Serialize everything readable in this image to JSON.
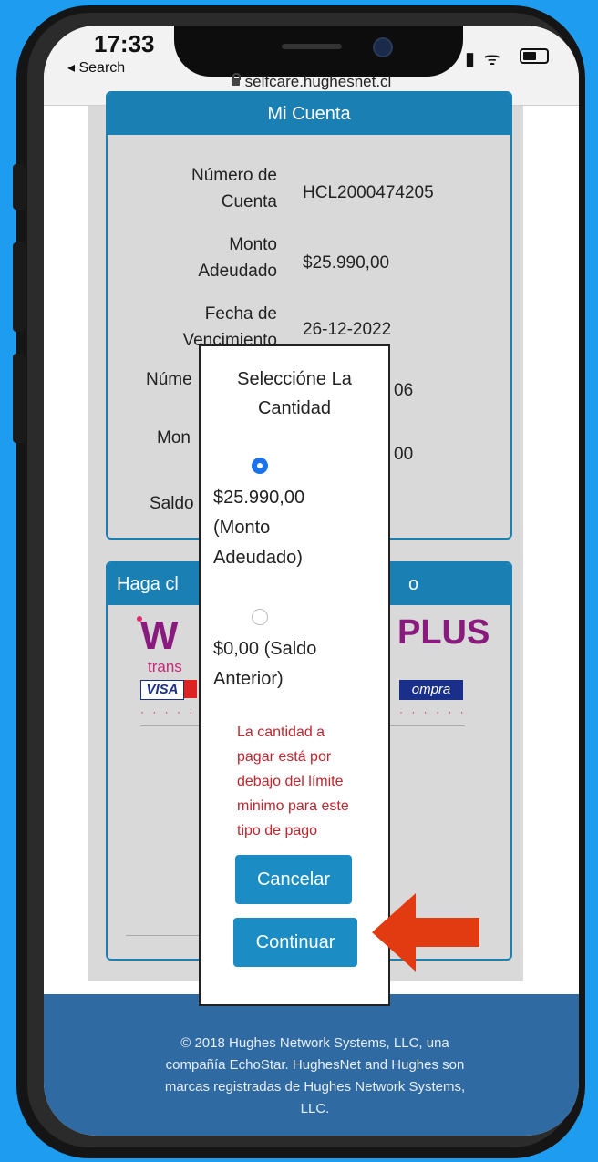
{
  "status_bar": {
    "time": "17:33",
    "back_label": "◂ Search",
    "url": "selfcare.hughesnet.cl"
  },
  "account_card": {
    "title": "Mi Cuenta",
    "rows": [
      {
        "label_line1": "Número de",
        "label_line2": "Cuenta",
        "value": "HCL2000474205"
      },
      {
        "label_line1": "Monto",
        "label_line2": "Adeudado",
        "value": "$25.990,00"
      },
      {
        "label_line1": "Fecha de",
        "label_line2": "Vencimiento",
        "value": "26-12-2022"
      },
      {
        "label_partial": "Núme",
        "value_partial": "06"
      },
      {
        "label_partial": "Mon",
        "value_partial": "00"
      },
      {
        "label_partial": "Saldo"
      }
    ]
  },
  "payment_card": {
    "header_partial_left": "Haga cl",
    "header_partial_right": "o",
    "logo_left": "W",
    "logo_right": "PLUS",
    "logo_sub": "trans",
    "visa_label": "VISA",
    "compra_label": "ompra",
    "dots_left": "· · · · · ·",
    "dots_right": "· · · · · ·"
  },
  "modal": {
    "title_line1": "Seleccióne La",
    "title_line2": "Cantidad",
    "options": [
      {
        "line1": "$25.990,00",
        "line2": "(Monto",
        "line3": "Adeudado)",
        "selected": true
      },
      {
        "line1": "$0,00 (Saldo",
        "line2": "Anterior)",
        "selected": false
      }
    ],
    "error_lines": [
      "La cantidad a",
      "pagar está por",
      "debajo del límite",
      "minimo para este",
      "tipo de pago"
    ],
    "cancel_label": "Cancelar",
    "continue_label": "Continuar"
  },
  "footer": {
    "line1": "© 2018 Hughes Network Systems, LLC, una",
    "line2": "compañía EchoStar. HughesNet and Hughes son",
    "line3": "marcas registradas de Hughes Network Systems,",
    "line4": "LLC."
  },
  "colors": {
    "background": "#1e9cf0",
    "card_header": "#1a7fb3",
    "footer": "#2f6aa3",
    "button": "#1b8cc4",
    "error": "#c0262d",
    "arrow": "#e23b12"
  },
  "annotation": {
    "icon": "arrow-left-icon",
    "points_to": "continue-button"
  }
}
